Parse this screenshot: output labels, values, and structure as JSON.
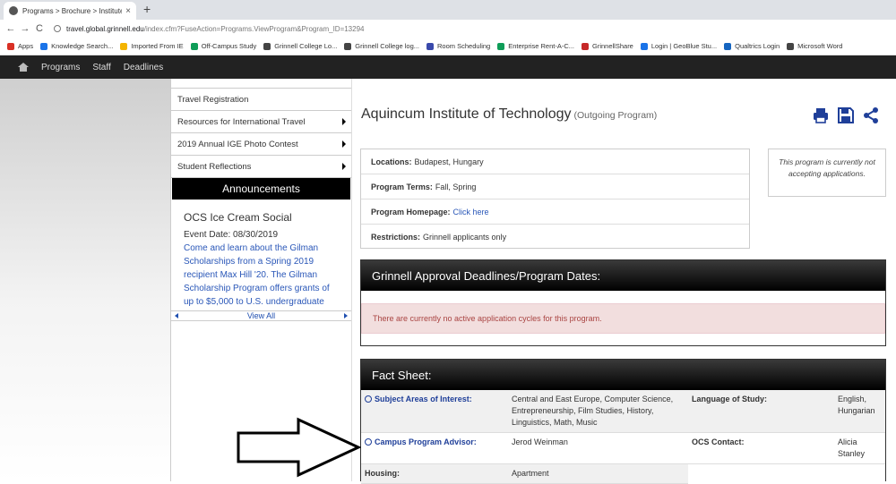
{
  "browser": {
    "tab_title": "Programs > Brochure > Institute",
    "tab_close": "×",
    "new_tab": "+",
    "url_host": "travel.global.grinnell.edu",
    "url_path": "/index.cfm?FuseAction=Programs.ViewProgram&Program_ID=13294",
    "nav": {
      "back": "←",
      "forward": "→",
      "reload": "C"
    },
    "bookmarks": [
      {
        "label": "Apps",
        "color": "#d93025"
      },
      {
        "label": "Knowledge Search...",
        "color": "#1a73e8"
      },
      {
        "label": "Imported From IE",
        "color": "#f4b400"
      },
      {
        "label": "Off-Campus Study",
        "color": "#0f9d58"
      },
      {
        "label": "Grinnell College Lo...",
        "color": "#444444"
      },
      {
        "label": "Grinnell College log...",
        "color": "#444444"
      },
      {
        "label": "Room Scheduling",
        "color": "#3949ab"
      },
      {
        "label": "Enterprise Rent-A-C...",
        "color": "#0f9d58"
      },
      {
        "label": "GrinnellShare",
        "color": "#c62828"
      },
      {
        "label": "Login | GeoBlue Stu...",
        "color": "#1a73e8"
      },
      {
        "label": "Qualtrics Login",
        "color": "#1565c0"
      },
      {
        "label": "Microsoft Word",
        "color": "#444444"
      }
    ]
  },
  "sitenav": {
    "items": [
      "Programs",
      "Staff",
      "Deadlines"
    ]
  },
  "sidebar": {
    "items": [
      {
        "label": "Travel Registration",
        "has_submenu": false
      },
      {
        "label": "Resources for International Travel",
        "has_submenu": true
      },
      {
        "label": "2019 Annual IGE Photo Contest",
        "has_submenu": true
      },
      {
        "label": "Student Reflections",
        "has_submenu": true
      }
    ],
    "announcements": {
      "title": "Announcements",
      "heading": "OCS Ice Cream Social",
      "date": "Event Date: 08/30/2019",
      "text": "Come and learn about the Gilman Scholarships from a Spring 2019 recipient Max Hill '20. The Gilman Scholarship Program offers grants of up to $5,000 to U.S. undergraduate students of high financial need",
      "view_all": "View All"
    }
  },
  "program": {
    "title": "Aquincum Institute of Technology",
    "subtitle": "(Outgoing Program)",
    "info": {
      "locations_label": "Locations:",
      "locations": "Budapest, Hungary",
      "terms_label": "Program Terms:",
      "terms": "Fall, Spring",
      "homepage_label": "Program Homepage:",
      "homepage": "Click here",
      "restrictions_label": "Restrictions:",
      "restrictions": "Grinnell applicants only"
    },
    "notice": "This program is currently not accepting applications."
  },
  "deadlines": {
    "title": "Grinnell Approval Deadlines/Program Dates:",
    "alert": "There are currently no active application cycles for this program."
  },
  "factsheet": {
    "title": "Fact Sheet:",
    "subject_label": "Subject Areas of Interest:",
    "subject_value": "Central and East Europe, Computer Science, Entrepreneurship, Film Studies, History, Linguistics, Math, Music",
    "language_label": "Language of Study:",
    "language_value": "English, Hungarian",
    "advisor_label": "Campus Program Advisor:",
    "advisor_value": "Jerod Weinman",
    "ocs_label": "OCS Contact:",
    "ocs_value": "Alicia Stanley",
    "housing_label": "Housing:",
    "housing_value": "Apartment"
  },
  "colors": {
    "link": "#2a57b8",
    "nav_bg": "#222222",
    "alert_bg": "#f2dede",
    "alert_text": "#a94442",
    "icon_blue": "#1f3f99"
  }
}
